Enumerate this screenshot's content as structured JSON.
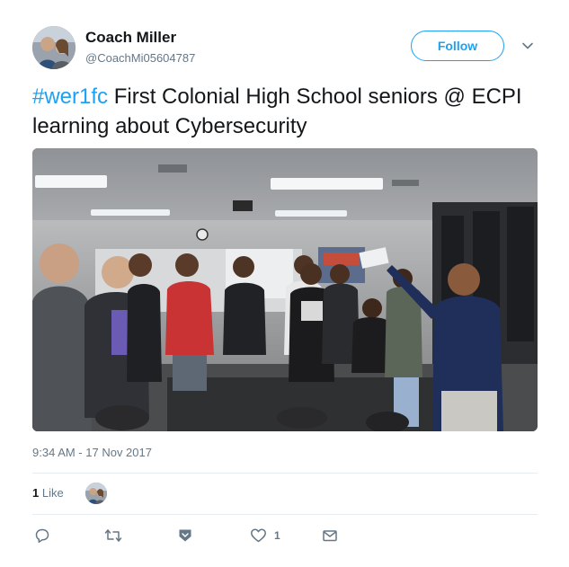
{
  "tweet": {
    "author": {
      "name": "Coach Miller",
      "handle": "@CoachMi05604787",
      "avatar_icon": "profile-photo"
    },
    "follow_label": "Follow",
    "caret_icon": "chevron-down-icon",
    "text": {
      "hashtag": "#wer1fc",
      "body": " First Colonial High School seniors @ ECPI learning about Cybersecurity"
    },
    "media": {
      "alt": "Students standing in a computer lab classroom listening to an instructor"
    },
    "timestamp": "9:34 AM - 17 Nov 2017",
    "likes": {
      "count": "1",
      "label": "Like"
    },
    "actions": {
      "reply_icon": "reply-icon",
      "retweet_icon": "retweet-icon",
      "bookmark_icon": "bookmark-icon",
      "like_icon": "heart-icon",
      "like_count": "1",
      "message_icon": "envelope-icon"
    },
    "colors": {
      "accent": "#1da1f2",
      "secondary_text": "#657786",
      "primary_text": "#14171a",
      "divider": "#e6ecf0"
    }
  }
}
